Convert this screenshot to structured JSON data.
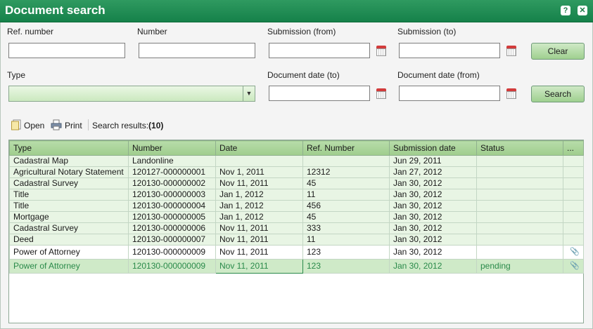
{
  "window": {
    "title": "Document search",
    "help_glyph": "?",
    "close_glyph": "✕"
  },
  "form": {
    "ref_number_label": "Ref. number",
    "number_label": "Number",
    "submission_from_label": "Submission (from)",
    "submission_to_label": "Submission (to)",
    "type_label": "Type",
    "document_date_to_label": "Document date (to)",
    "document_date_from_label": "Document date (from)",
    "ref_number_value": "",
    "number_value": "",
    "submission_from_value": "",
    "submission_to_value": "",
    "type_value": "",
    "document_date_to_value": "",
    "document_date_from_value": "",
    "clear_label": "Clear",
    "search_label": "Search",
    "dropdown_glyph": "▼"
  },
  "toolbar": {
    "open_label": "Open",
    "print_label": "Print",
    "results_label": "Search results:",
    "results_count": "(10)"
  },
  "grid": {
    "columns": [
      "Type",
      "Number",
      "Date",
      "Ref. Number",
      "Submission date",
      "Status",
      "..."
    ],
    "attachment_glyph": "📎",
    "rows": [
      [
        "Cadastral Map",
        "Landonline",
        "",
        "",
        "Jun 29, 2011",
        "",
        ""
      ],
      [
        "Agricultural Notary Statement",
        "120127-000000001",
        "Nov 1, 2011",
        "12312",
        "Jan 27, 2012",
        "",
        ""
      ],
      [
        "Cadastral Survey",
        "120130-000000002",
        "Nov 11, 2011",
        "45",
        "Jan 30, 2012",
        "",
        ""
      ],
      [
        "Title",
        "120130-000000003",
        "Jan 1, 2012",
        "11",
        "Jan 30, 2012",
        "",
        ""
      ],
      [
        "Title",
        "120130-000000004",
        "Jan 1, 2012",
        "456",
        "Jan 30, 2012",
        "",
        ""
      ],
      [
        "Mortgage",
        "120130-000000005",
        "Jan 1, 2012",
        "45",
        "Jan 30, 2012",
        "",
        ""
      ],
      [
        "Cadastral Survey",
        "120130-000000006",
        "Nov 11, 2011",
        "333",
        "Jan 30, 2012",
        "",
        ""
      ],
      [
        "Deed",
        "120130-000000007",
        "Nov 11, 2011",
        "11",
        "Jan 30, 2012",
        "",
        ""
      ],
      [
        "Power of Attorney",
        "120130-000000009",
        "Nov 11, 2011",
        "123",
        "Jan 30, 2012",
        "",
        ""
      ],
      [
        "Power of Attorney",
        "120130-000000009",
        "Nov 11, 2011",
        "123",
        "Jan 30, 2012",
        "pending",
        ""
      ]
    ]
  },
  "colors": {
    "title_bar": "#15814a",
    "header": "#a6d294",
    "row": "#e8f5e4",
    "selected_text": "#2a8a4a"
  }
}
